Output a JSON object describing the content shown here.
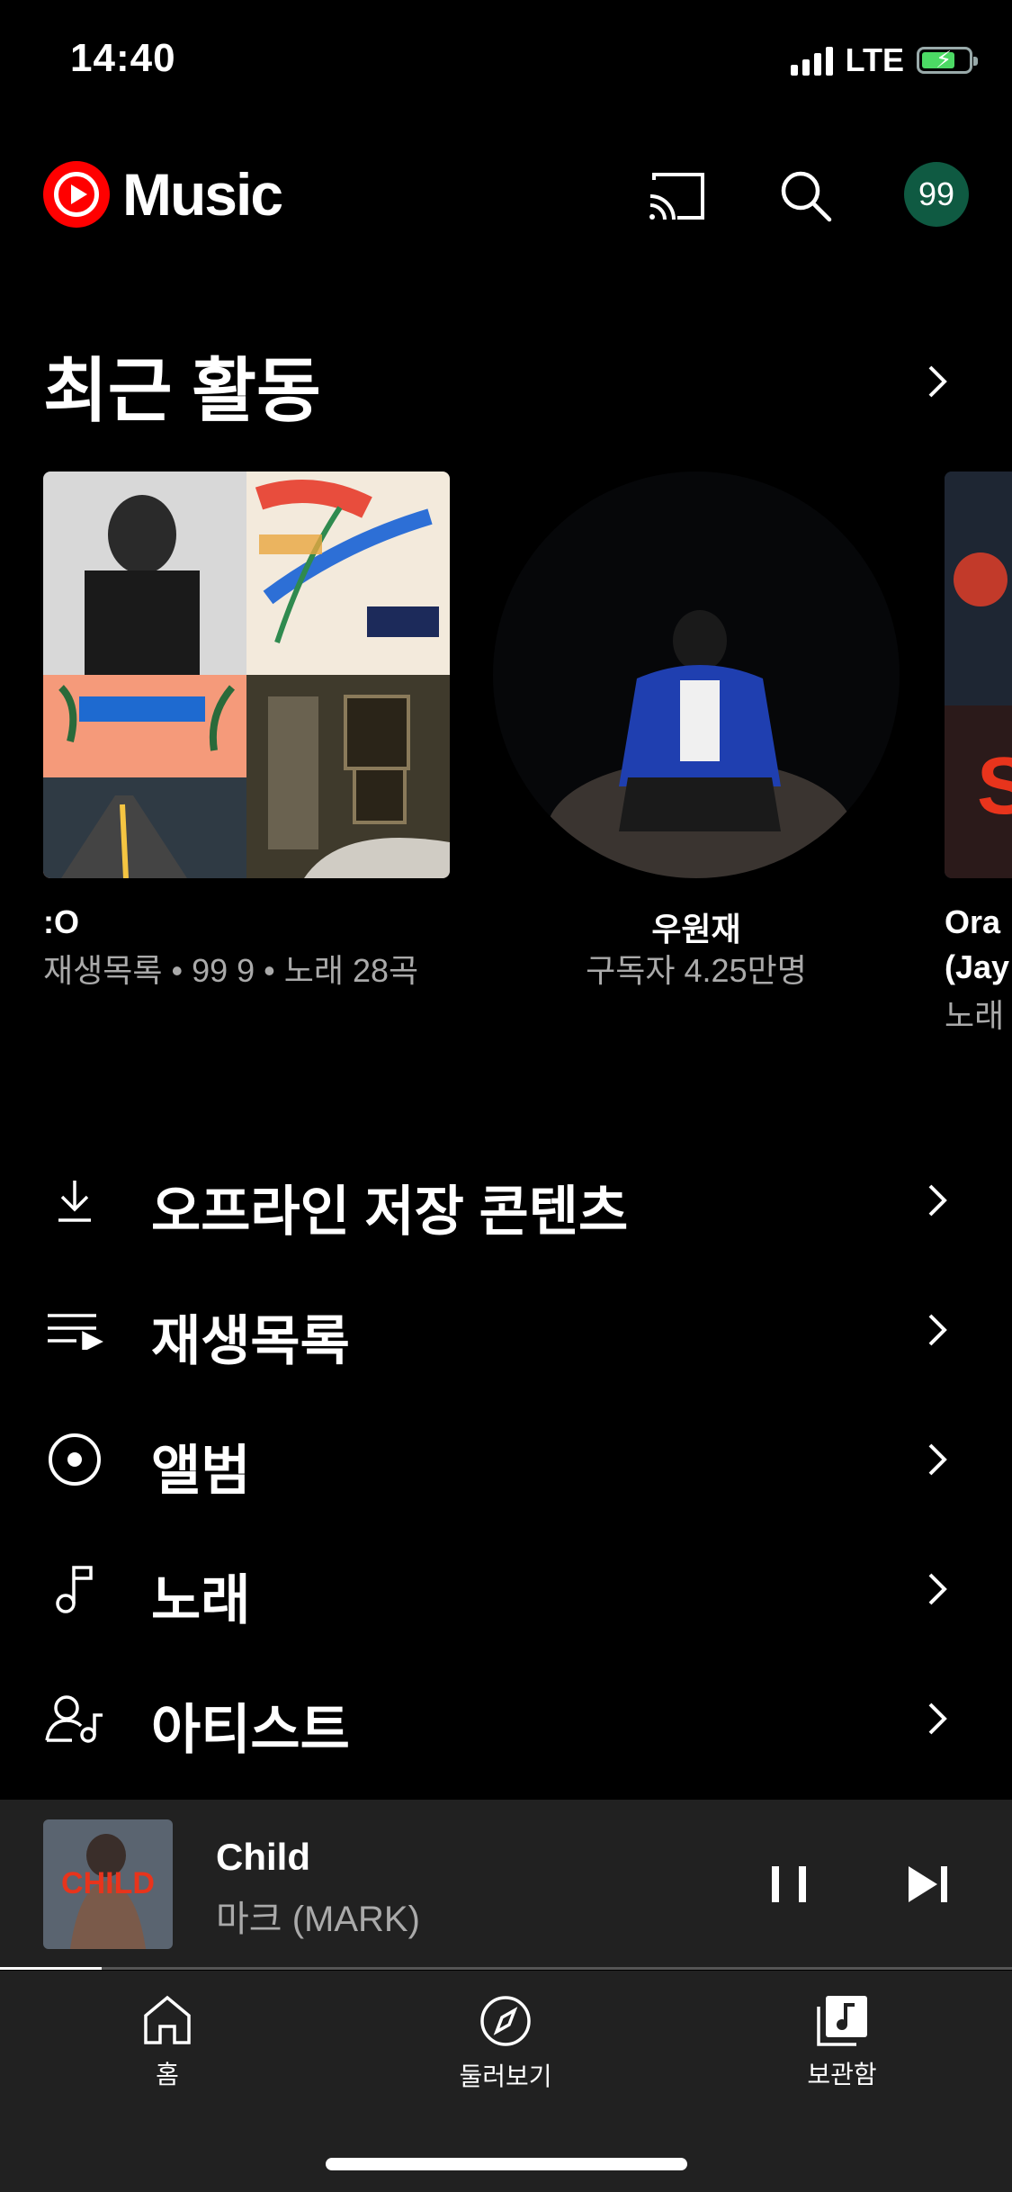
{
  "status_bar": {
    "time": "14:40",
    "network": "LTE"
  },
  "header": {
    "logo_text": "Music",
    "avatar_text": "99"
  },
  "recent": {
    "title": "최근 활동",
    "cards": [
      {
        "title": ":O",
        "subtitle": "재생목록 • 99 9 • 노래 28곡"
      },
      {
        "title": "우원재",
        "subtitle": "구독자 4.25만명"
      },
      {
        "title": "Ora",
        "title2": "(Jay",
        "subtitle": "노래"
      }
    ]
  },
  "library_menu": [
    {
      "label": "오프라인 저장 콘텐츠",
      "icon": "download-icon"
    },
    {
      "label": "재생목록",
      "icon": "playlist-icon"
    },
    {
      "label": "앨범",
      "icon": "album-icon"
    },
    {
      "label": "노래",
      "icon": "music-note-icon"
    },
    {
      "label": "아티스트",
      "icon": "artist-icon"
    }
  ],
  "mini_player": {
    "title": "Child",
    "artist": "마크 (MARK)",
    "art_text": "CHILD",
    "progress": 0.1
  },
  "bottom_nav": [
    {
      "label": "홈",
      "icon": "home-icon"
    },
    {
      "label": "둘러보기",
      "icon": "explore-icon"
    },
    {
      "label": "보관함",
      "icon": "library-icon"
    }
  ],
  "colors": {
    "accent": "#ff0000",
    "avatar_bg": "#0f5a42",
    "mini_player_bg": "#212121"
  }
}
